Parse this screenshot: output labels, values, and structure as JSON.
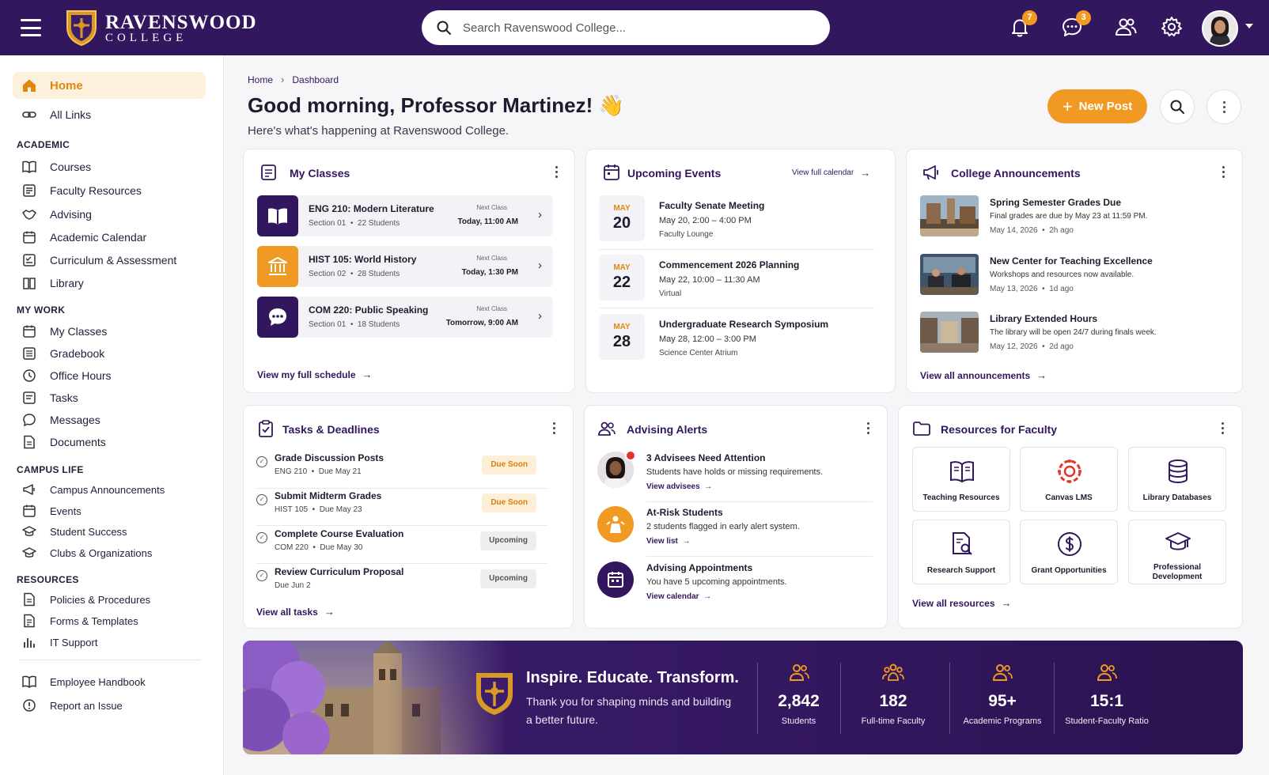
{
  "brand": {
    "name": "RAVENSWOOD",
    "sub": "COLLEGE"
  },
  "search": {
    "placeholder": "Search Ravenswood College..."
  },
  "topbar": {
    "notifications_count": "7",
    "messages_count": "3"
  },
  "sidebar": {
    "home": "Home",
    "all_links": "All Links",
    "academic": {
      "heading": "ACADEMIC",
      "items": [
        "Courses",
        "Faculty Resources",
        "Advising",
        "Academic Calendar",
        "Curriculum & Assessment",
        "Library"
      ]
    },
    "my_work": {
      "heading": "MY WORK",
      "items": [
        "My Classes",
        "Gradebook",
        "Office Hours",
        "Tasks",
        "Messages",
        "Documents"
      ]
    },
    "campus_life": {
      "heading": "CAMPUS LIFE",
      "items": [
        "Campus Announcements",
        "Events",
        "Student Success",
        "Clubs & Organizations"
      ]
    },
    "resources": {
      "heading": "RESOURCES",
      "items": [
        "Policies & Procedures",
        "Forms & Templates",
        "IT Support"
      ]
    },
    "footer": [
      "Employee Handbook",
      "Report an Issue"
    ]
  },
  "breadcrumb": [
    "Home",
    "Dashboard"
  ],
  "header": {
    "greeting": "Good morning, Professor Martinez! 👋",
    "subtitle": "Here's what's happening at Ravenswood College.",
    "new_post": "New Post"
  },
  "my_classes": {
    "title": "My Classes",
    "rows": [
      {
        "name": "ENG 210: Modern Literature",
        "section": "Section 01",
        "students": "22 Students",
        "next_label": "Next Class",
        "next_time": "Today, 11:00 AM"
      },
      {
        "name": "HIST 105: World History",
        "section": "Section 02",
        "students": "28 Students",
        "next_label": "Next Class",
        "next_time": "Today, 1:30 PM"
      },
      {
        "name": "COM 220: Public Speaking",
        "section": "Section 01",
        "students": "18 Students",
        "next_label": "Next Class",
        "next_time": "Tomorrow, 9:00 AM"
      }
    ],
    "link": "View my full schedule"
  },
  "events": {
    "title": "Upcoming Events",
    "link": "View full calendar",
    "items": [
      {
        "month": "MAY",
        "day": "20",
        "title": "Faculty Senate Meeting",
        "time": "May 20, 2:00 – 4:00 PM",
        "location": "Faculty Lounge"
      },
      {
        "month": "MAY",
        "day": "22",
        "title": "Commencement 2026 Planning",
        "time": "May 22, 10:00 – 11:30 AM",
        "location": "Virtual"
      },
      {
        "month": "MAY",
        "day": "28",
        "title": "Undergraduate Research Symposium",
        "time": "May 28, 12:00 – 3:00 PM",
        "location": "Science Center Atrium"
      }
    ]
  },
  "announcements": {
    "title": "College Announcements",
    "items": [
      {
        "title": "Spring Semester Grades Due",
        "desc": "Final grades are due by May 23 at 11:59 PM.",
        "date": "May 14, 2026",
        "ago": "2h ago"
      },
      {
        "title": "New Center for Teaching Excellence",
        "desc": "Workshops and resources now available.",
        "date": "May 13, 2026",
        "ago": "1d ago"
      },
      {
        "title": "Library Extended Hours",
        "desc": "The library will be open 24/7 during finals week.",
        "date": "May 12, 2026",
        "ago": "2d ago"
      }
    ],
    "link": "View all announcements"
  },
  "tasks": {
    "title": "Tasks & Deadlines",
    "items": [
      {
        "title": "Grade Discussion Posts",
        "course": "ENG 210",
        "due": "Due May 21",
        "status": "Due Soon"
      },
      {
        "title": "Submit Midterm Grades",
        "course": "HIST 105",
        "due": "Due May 23",
        "status": "Due Soon"
      },
      {
        "title": "Complete Course Evaluation",
        "course": "COM 220",
        "due": "Due May 30",
        "status": "Upcoming"
      },
      {
        "title": "Review Curriculum Proposal",
        "course": "",
        "due": "Due Jun 2",
        "status": "Upcoming"
      }
    ],
    "link": "View all tasks"
  },
  "advising": {
    "title": "Advising Alerts",
    "items": [
      {
        "title": "3 Advisees Need Attention",
        "desc": "Students have holds or missing requirements.",
        "link": "View advisees"
      },
      {
        "title": "At-Risk Students",
        "desc": "2 students flagged in early alert system.",
        "link": "View list"
      },
      {
        "title": "Advising Appointments",
        "desc": "You have 5 upcoming appointments.",
        "link": "View calendar"
      }
    ]
  },
  "resources": {
    "title": "Resources for Faculty",
    "tiles": [
      "Teaching Resources",
      "Canvas LMS",
      "Library Databases",
      "Research Support",
      "Grant Opportunities",
      "Professional Development"
    ],
    "link": "View all resources"
  },
  "banner": {
    "headline": "Inspire. Educate. Transform.",
    "sub": "Thank you for shaping minds and building a better future.",
    "stats": [
      {
        "value": "2,842",
        "label": "Students"
      },
      {
        "value": "182",
        "label": "Full-time Faculty"
      },
      {
        "value": "95+",
        "label": "Academic Programs"
      },
      {
        "value": "15:1",
        "label": "Student-Faculty Ratio"
      }
    ]
  },
  "colors": {
    "brand_purple": "#33175e",
    "accent_orange": "#f19a23",
    "soon_bg": "#fdeed8"
  }
}
